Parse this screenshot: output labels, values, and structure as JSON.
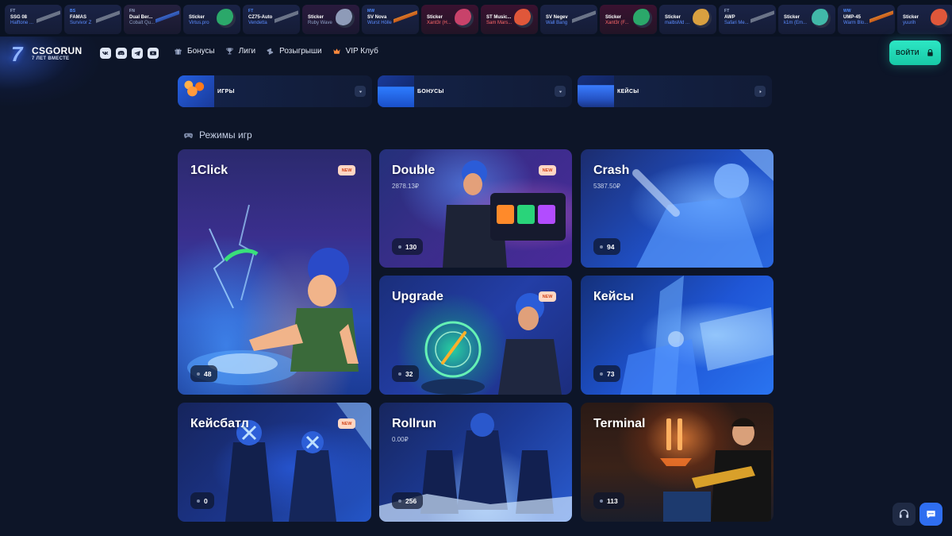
{
  "ticker": [
    {
      "wear": "FT",
      "weapon": "SSG 08",
      "skin": "Halftone ...",
      "art": "gun",
      "rarity": "mil"
    },
    {
      "wear": "BS",
      "weapon": "FAMAS",
      "skin": "Survivor Z",
      "art": "gun",
      "rarity": "mil"
    },
    {
      "wear": "FN",
      "weapon": "Dual Ber...",
      "skin": "Cobalt Qu...",
      "art": "gun",
      "rarity": "classified"
    },
    {
      "wear": "",
      "weapon": "Sticker",
      "skin": "Virtus.pro",
      "art": "sticker",
      "rarity": "mil"
    },
    {
      "wear": "FT",
      "weapon": "CZ75-Auto",
      "skin": "Vendetta",
      "art": "gun",
      "rarity": "mil"
    },
    {
      "wear": "",
      "weapon": "Sticker",
      "skin": "Ruby Wave",
      "art": "sticker",
      "rarity": "covert"
    },
    {
      "wear": "MW",
      "weapon": "SV Nova",
      "skin": "Wurst Hölle",
      "art": "gun-orange",
      "rarity": "mil"
    },
    {
      "wear": "",
      "weapon": "Sticker",
      "skin": "Xant3r (H...",
      "art": "sticker",
      "rarity": "extra"
    },
    {
      "wear": "",
      "weapon": "ST Music...",
      "skin": "Sam Mars...",
      "art": "sticker",
      "rarity": "extra"
    },
    {
      "wear": "",
      "weapon": "SV Negev",
      "skin": "Wall Bang",
      "art": "gun",
      "rarity": "mil"
    },
    {
      "wear": "",
      "weapon": "Sticker",
      "skin": "Xant3r (F...",
      "art": "sticker",
      "rarity": "extra"
    },
    {
      "wear": "",
      "weapon": "Sticker",
      "skin": "malbsMd ...",
      "art": "sticker",
      "rarity": "mil"
    },
    {
      "wear": "FT",
      "weapon": "AWP",
      "skin": "Safari Me...",
      "art": "gun",
      "rarity": "mil"
    },
    {
      "wear": "",
      "weapon": "Sticker",
      "skin": "k1m (Em...",
      "art": "sticker",
      "rarity": "mil"
    },
    {
      "wear": "WW",
      "weapon": "UMP-45",
      "skin": "Warm Blo...",
      "art": "gun-orange",
      "rarity": "mil"
    },
    {
      "wear": "",
      "weapon": "Sticker",
      "skin": "yuurih",
      "art": "sticker",
      "rarity": "mil"
    }
  ],
  "header": {
    "logo_mark": "7",
    "logo_name": "CSGORUN",
    "logo_tagline": "7 ЛЕТ ВМЕСТЕ",
    "socials": [
      "vk-icon",
      "discord-icon",
      "telegram-icon",
      "youtube-icon"
    ],
    "nav": [
      {
        "label": "Бонусы",
        "icon": "gift-icon"
      },
      {
        "label": "Лиги",
        "icon": "trophy-icon"
      },
      {
        "label": "Розыгрыши",
        "icon": "ticket-icon"
      },
      {
        "label": "VIP Клуб",
        "icon": "crown-icon"
      }
    ],
    "login_label": "ВОЙТИ"
  },
  "categories": [
    {
      "label": "ИГРЫ",
      "control": "chevron-down-icon"
    },
    {
      "label": "БОНУСЫ",
      "control": "chevron-down-icon"
    },
    {
      "label": "КЕЙСЫ",
      "control": "chevron-right-icon"
    }
  ],
  "section": {
    "title": "Режимы игр",
    "icon": "gamepad-icon"
  },
  "games": [
    {
      "title": "1Click",
      "balance": "",
      "online": "48",
      "is_new": true,
      "new_label": "NEW"
    },
    {
      "title": "Double",
      "balance": "2878.13₽",
      "online": "130",
      "is_new": true,
      "new_label": "NEW"
    },
    {
      "title": "Crash",
      "balance": "5387.50₽",
      "online": "94",
      "is_new": false
    },
    {
      "title": "Upgrade",
      "balance": "",
      "online": "32",
      "is_new": true,
      "new_label": "NEW"
    },
    {
      "title": "Кейсы",
      "balance": "",
      "online": "73",
      "is_new": false
    },
    {
      "title": "Кейсбатл",
      "balance": "",
      "online": "0",
      "is_new": true,
      "new_label": "NEW"
    },
    {
      "title": "Rollrun",
      "balance": "0.00₽",
      "online": "256",
      "is_new": false
    },
    {
      "title": "Terminal",
      "balance": "",
      "online": "113",
      "is_new": false
    }
  ],
  "floating": {
    "support": "headset-icon",
    "chat": "chat-bubble-icon"
  },
  "colors": {
    "background": "#0d1528",
    "accent": "#1fd8b4",
    "new_badge_bg": "#ffd7c4",
    "new_badge_text": "#d1481f",
    "chat_button": "#2f6ef0"
  }
}
